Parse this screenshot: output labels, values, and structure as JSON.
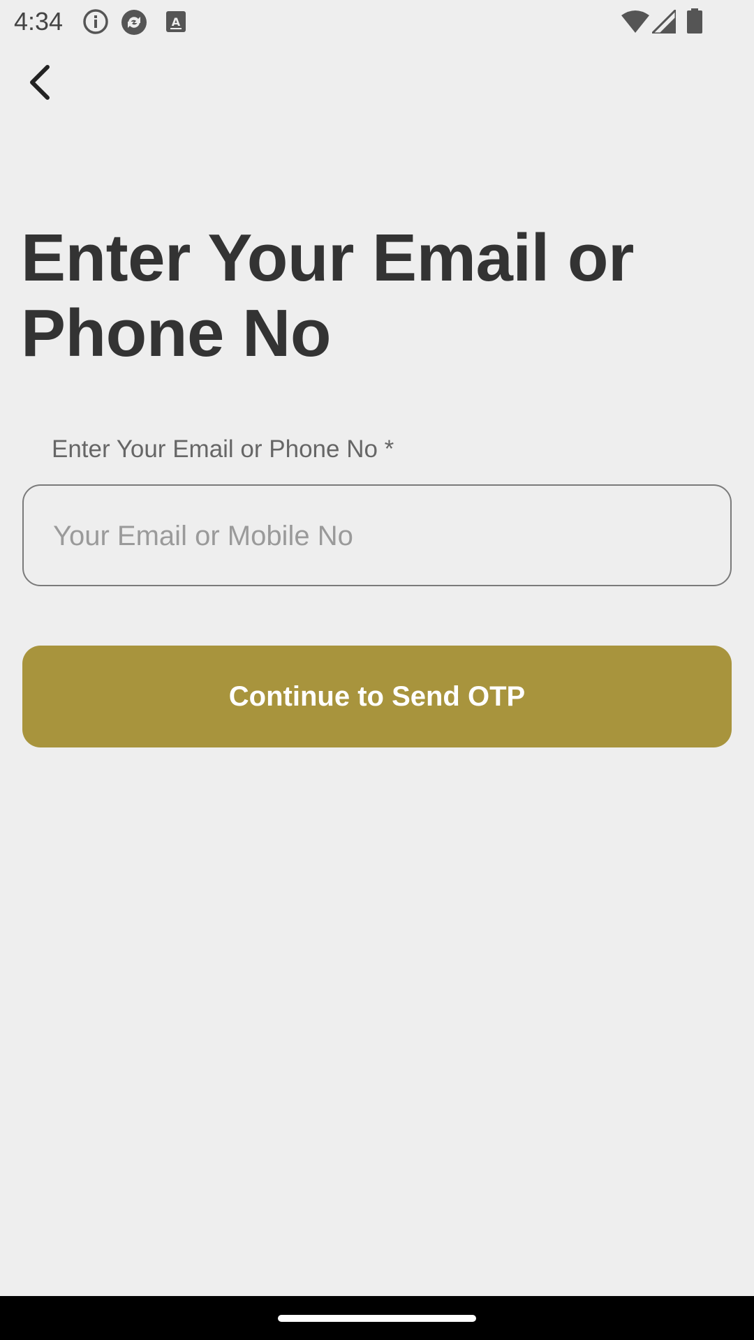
{
  "status_bar": {
    "time": "4:34",
    "icons": [
      "info-icon",
      "sync-app-icon",
      "keyboard-a-icon",
      "wifi-icon",
      "cellular-signal-icon",
      "battery-icon"
    ]
  },
  "navigation": {
    "back_icon": "chevron-left-icon"
  },
  "page": {
    "title": "Enter Your Email or Phone No"
  },
  "form": {
    "field_label": "Enter Your Email or Phone No *",
    "input_value": "",
    "input_placeholder": "Your Email or Mobile No",
    "submit_label": "Continue to Send OTP"
  },
  "colors": {
    "background": "#eeeeee",
    "accent": "#a8943d",
    "title_text": "#333333",
    "label_text": "#666666",
    "placeholder_text": "#9a9a9a"
  }
}
